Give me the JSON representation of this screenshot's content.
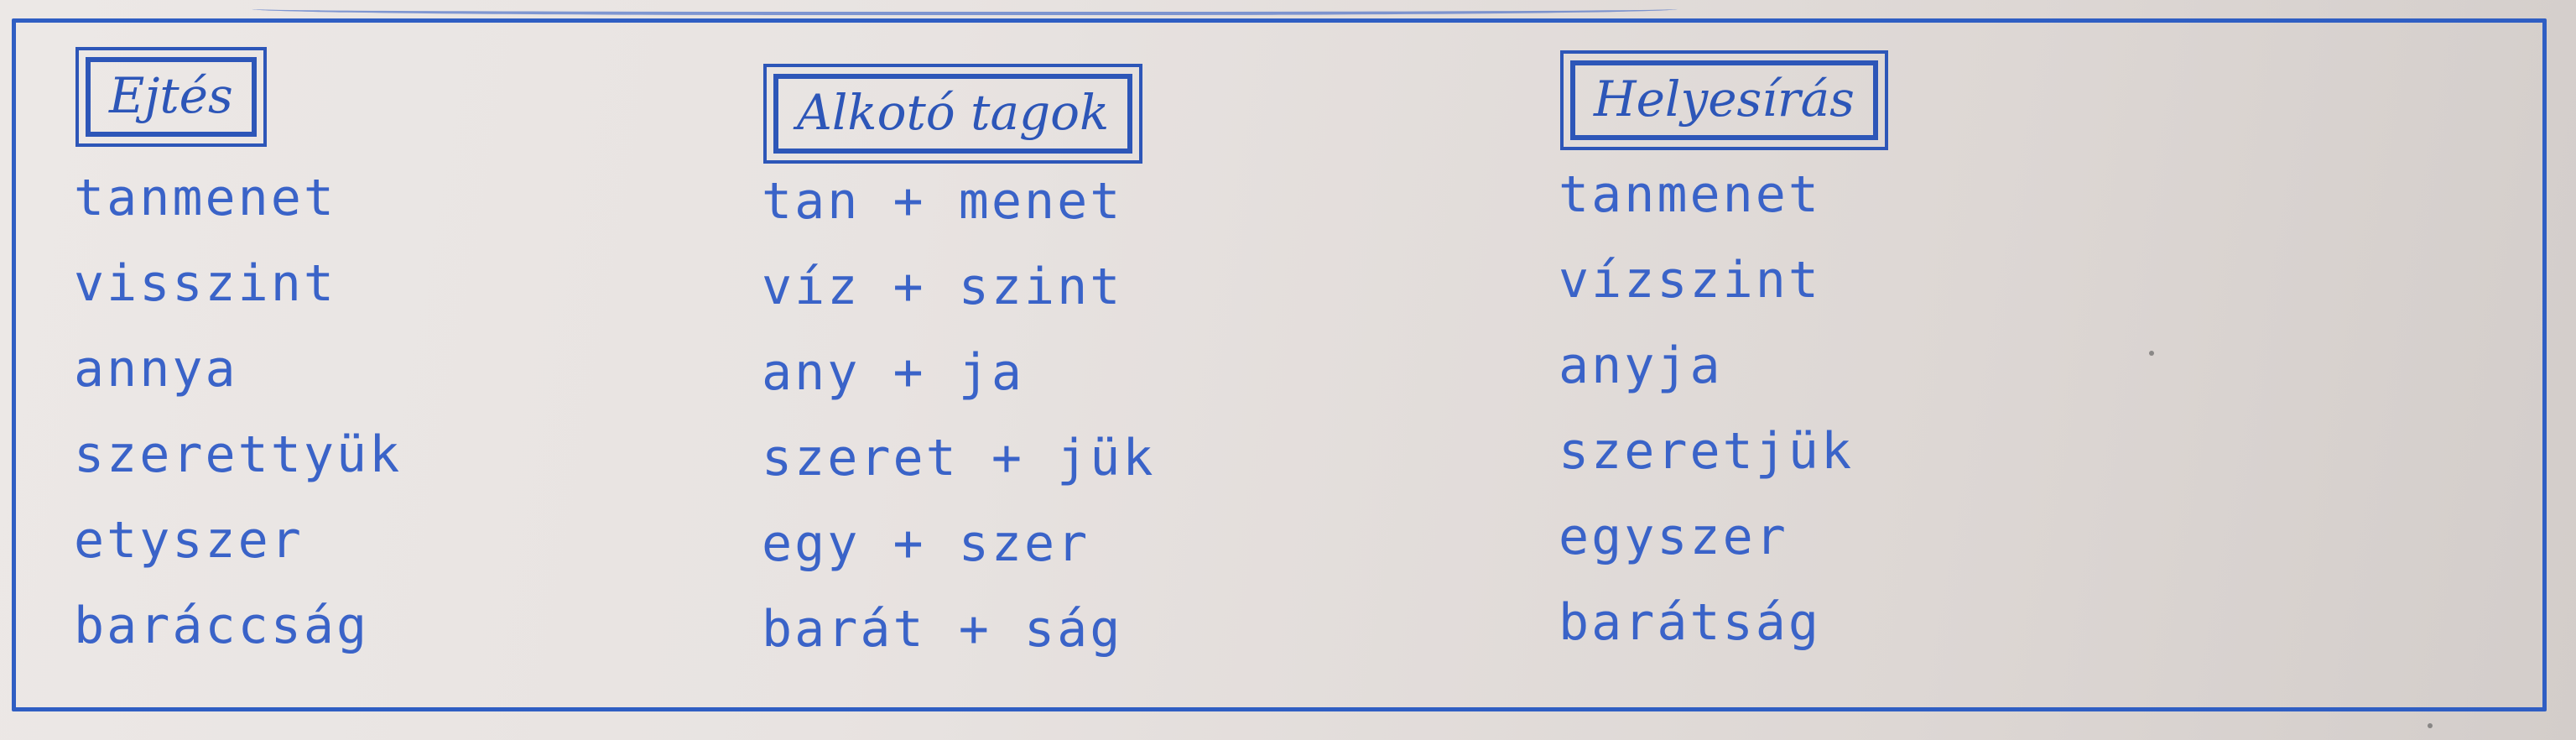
{
  "columns": [
    {
      "header": "Ejtés",
      "entries": [
        "tanmenet",
        "visszint",
        "annya",
        "szerettyük",
        "etyszer",
        "baráccság"
      ]
    },
    {
      "header": "Alkotó tagok",
      "entries": [
        "tan + menet",
        "víz + szint",
        "any + ja",
        "szeret + jük",
        "egy + szer",
        "barát + ság"
      ]
    },
    {
      "header": "Helyesírás",
      "entries": [
        "tanmenet",
        "vízszint",
        "anyja",
        "szeretjük",
        "egyszer",
        "barátság"
      ]
    }
  ]
}
